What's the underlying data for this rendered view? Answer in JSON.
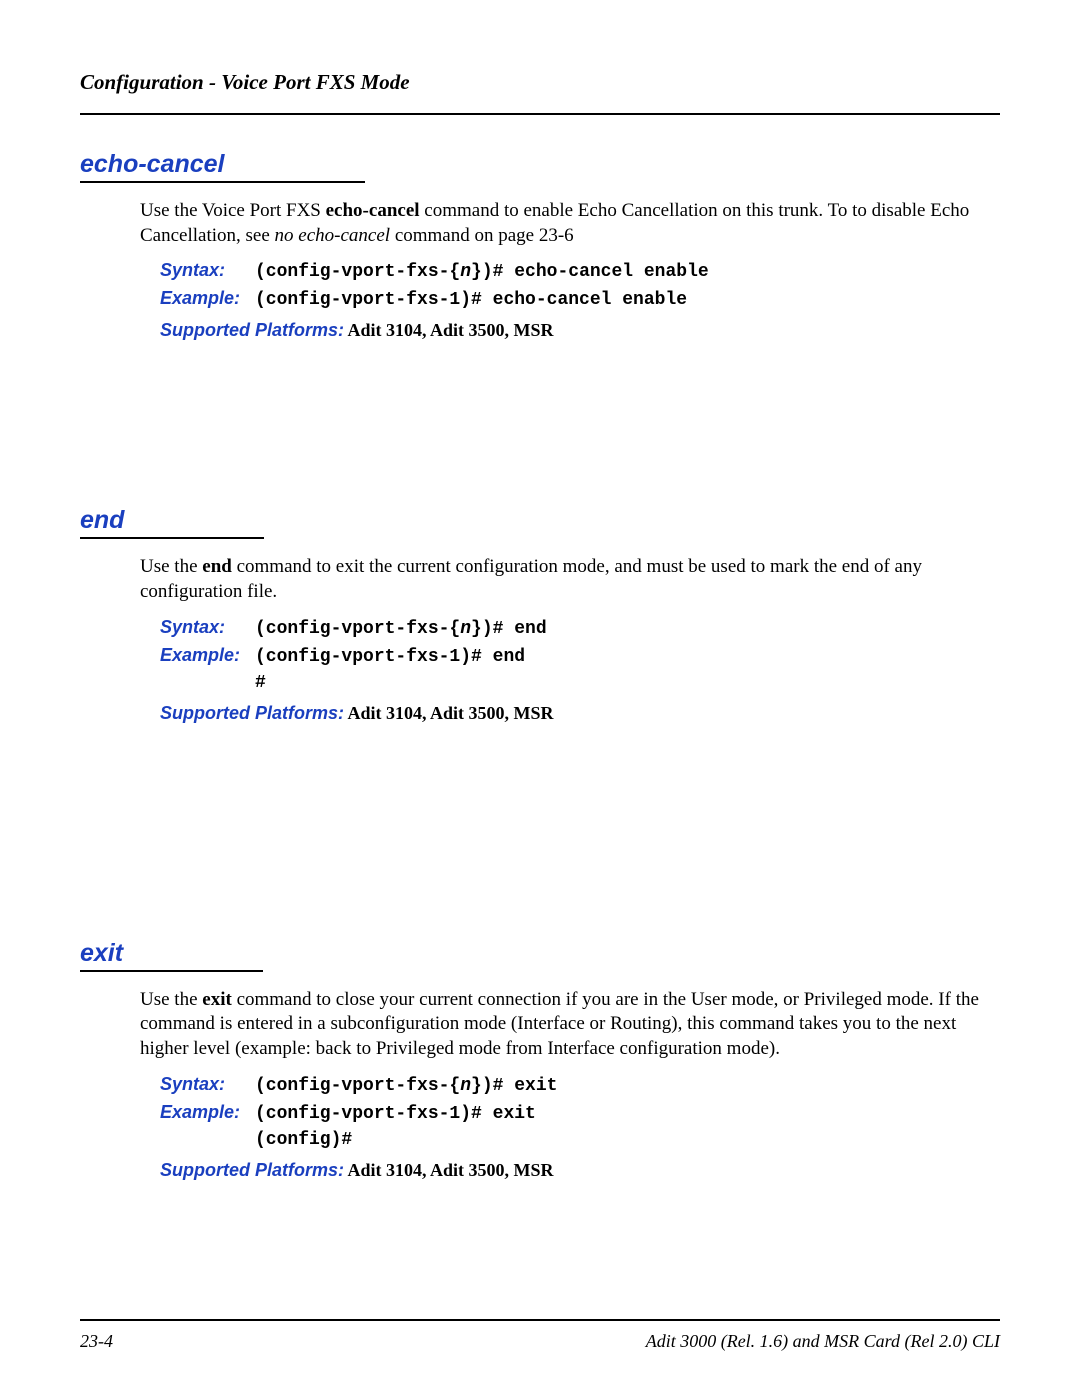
{
  "header": "Configuration - Voice Port FXS Mode",
  "sections": [
    {
      "title": "echo-cancel",
      "desc_pre": "Use the Voice Port FXS ",
      "desc_bold": "echo-cancel",
      "desc_mid": " command to enable Echo Cancellation on this trunk. To to disable Echo Cancellation, see ",
      "desc_ital": "no echo-cancel",
      "desc_post": " command on page 23-6",
      "syntax_label": "Syntax:",
      "syntax_pre": "(config-vport-fxs-{",
      "syntax_n": "n",
      "syntax_post": "})# echo-cancel enable",
      "example_label": "Example:",
      "example": "(config-vport-fxs-1)# echo-cancel enable",
      "extra": [],
      "platforms_label": "Supported Platforms:",
      "platforms_value": "  Adit 3104, Adit 3500, MSR"
    },
    {
      "title": "end",
      "desc_pre": "Use the ",
      "desc_bold": "end",
      "desc_mid": " command to exit the current configuration mode, and must be used to mark the end of any configuration file.",
      "desc_ital": "",
      "desc_post": "",
      "syntax_label": "Syntax:",
      "syntax_pre": "(config-vport-fxs-{",
      "syntax_n": "n",
      "syntax_post": "})# end",
      "example_label": "Example:",
      "example": "(config-vport-fxs-1)# end",
      "extra": [
        "#"
      ],
      "platforms_label": "Supported Platforms:",
      "platforms_value": "  Adit 3104, Adit 3500, MSR"
    },
    {
      "title": "exit",
      "desc_pre": "Use the ",
      "desc_bold": "exit",
      "desc_mid": " command to close your current connection if you are in the User mode, or Privileged mode. If the command is entered in a subconfiguration mode (Interface or Routing), this command takes you to the next higher level (example: back to Privileged mode from Interface configuration mode).",
      "desc_ital": "",
      "desc_post": "",
      "syntax_label": "Syntax:",
      "syntax_pre": "(config-vport-fxs-{",
      "syntax_n": "n",
      "syntax_post": "})# exit",
      "example_label": "Example:",
      "example": "(config-vport-fxs-1)# exit",
      "extra": [
        "(config)#"
      ],
      "platforms_label": "Supported Platforms:",
      "platforms_value": "  Adit 3104, Adit 3500, MSR"
    }
  ],
  "footer": {
    "left": "23-4",
    "right": "Adit 3000 (Rel. 1.6) and MSR Card (Rel 2.0) CLI"
  }
}
